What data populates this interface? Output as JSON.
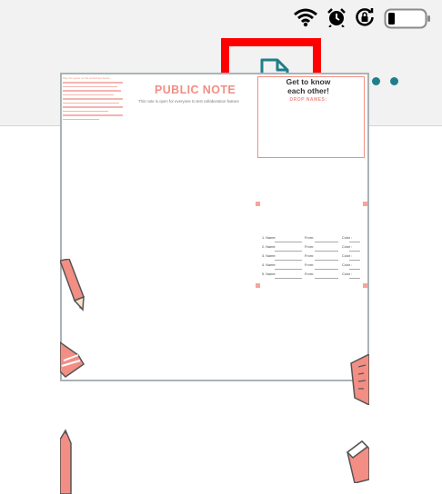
{
  "toolbar": {
    "new_document_icon": "document-plus-icon",
    "more_icon": "ellipsis-icon",
    "accent_color": "#1f7f8a",
    "highlight_color": "#ff0000"
  },
  "status_bar": {
    "icons": [
      "wifi-icon",
      "alarm-icon",
      "rotation-lock-icon",
      "battery-icon"
    ]
  },
  "document": {
    "title": "PUBLIC NOTE",
    "subtitle": "This note is open for everyone to test collaboration feature",
    "instructions_heading": "Play the game on the worksheet below",
    "card": {
      "heading_line1": "Get to know",
      "heading_line2": "each other!",
      "subheading": "DROP NAMES:",
      "rows": [
        {
          "name": "1. Name:",
          "from": "From:",
          "color": "Color :"
        },
        {
          "name": "2. Name:",
          "from": "From:",
          "color": "Color :"
        },
        {
          "name": "3. Name:",
          "from": "From:",
          "color": "Color :"
        },
        {
          "name": "4. Name:",
          "from": "From:",
          "color": "Color :"
        },
        {
          "name": "5. Name:",
          "from": "From:",
          "color": "Color :"
        }
      ]
    }
  }
}
